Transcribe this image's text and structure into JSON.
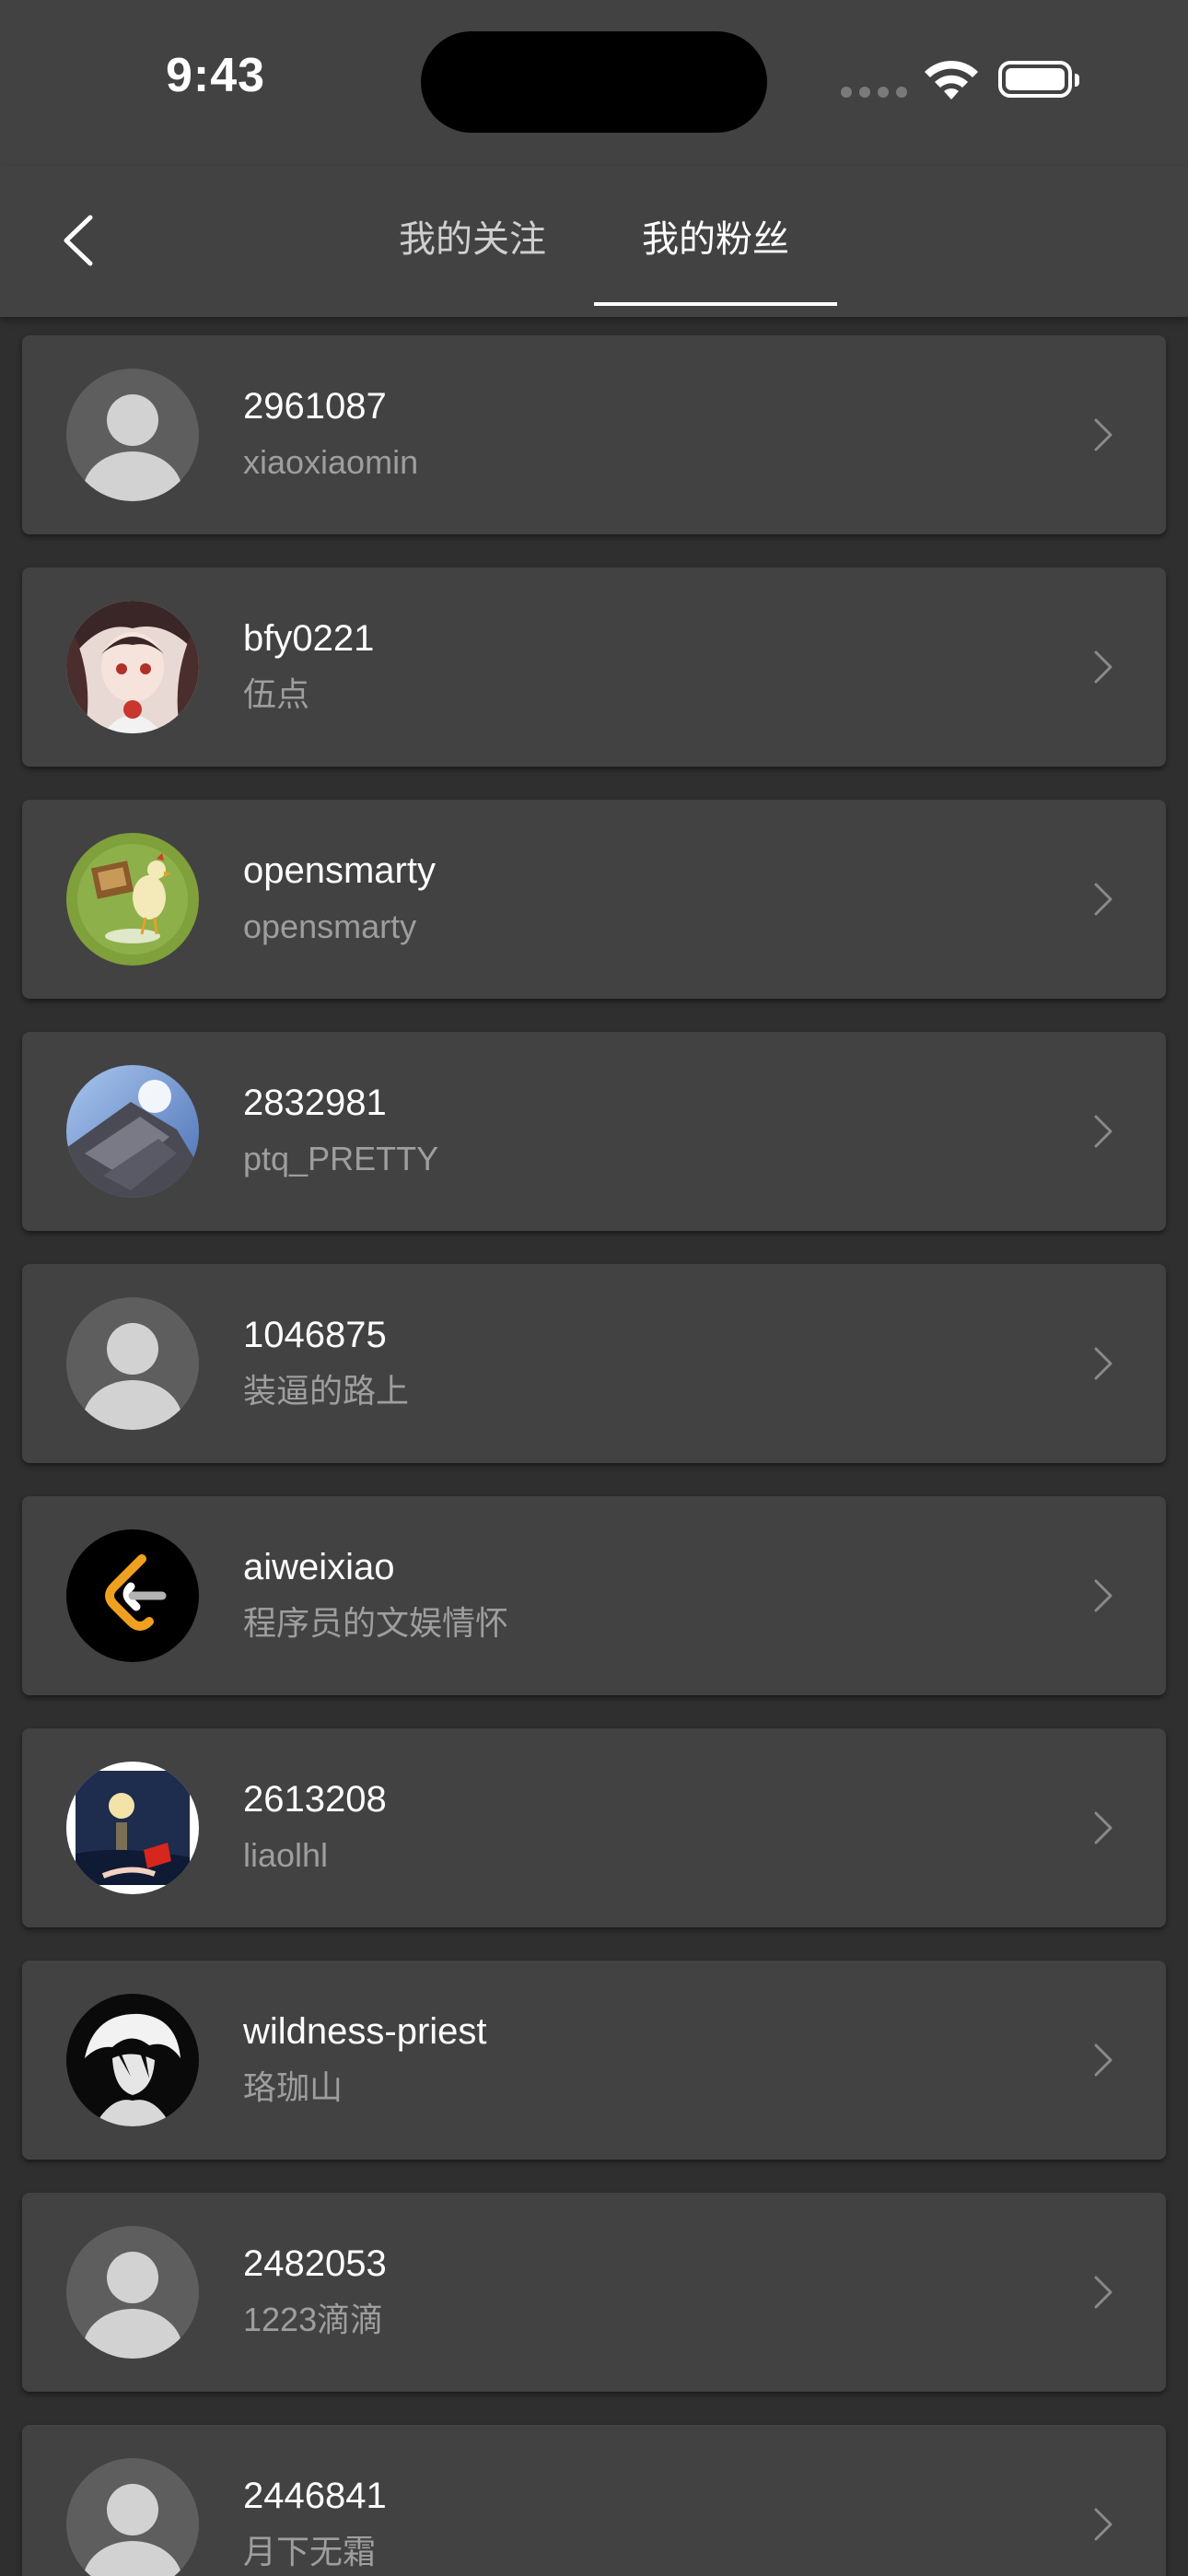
{
  "status_bar": {
    "time": "9:43"
  },
  "nav": {
    "back_icon": "chevron-left-icon",
    "tabs": [
      {
        "label": "我的关注",
        "selected": false
      },
      {
        "label": "我的粉丝",
        "selected": true
      }
    ]
  },
  "followers": [
    {
      "name": "2961087",
      "subtitle": "xiaoxiaomin",
      "avatar": "default-avatar-icon"
    },
    {
      "name": "bfy0221",
      "subtitle": "伍点",
      "avatar": "anime-girl-avatar"
    },
    {
      "name": "opensmarty",
      "subtitle": "opensmarty",
      "avatar": "rooster-avatar"
    },
    {
      "name": "2832981",
      "subtitle": "ptq_PRETTY",
      "avatar": "sky-building-avatar"
    },
    {
      "name": "1046875",
      "subtitle": "装逼的路上",
      "avatar": "default-avatar-icon"
    },
    {
      "name": "aiweixiao",
      "subtitle": "程序员的文娱情怀",
      "avatar": "leetcode-logo-avatar"
    },
    {
      "name": "2613208",
      "subtitle": "liaolhl",
      "avatar": "moon-flag-avatar"
    },
    {
      "name": "wildness-priest",
      "subtitle": "珞珈山",
      "avatar": "ink-portrait-avatar"
    },
    {
      "name": "2482053",
      "subtitle": "1223滴滴",
      "avatar": "default-avatar-icon"
    },
    {
      "name": "2446841",
      "subtitle": "月下无霜",
      "avatar": "default-avatar-icon"
    }
  ],
  "colors": {
    "background": "#2f2f2f",
    "card": "#424242",
    "primary_text": "#ffffff",
    "secondary_text": "#9e9e9e"
  }
}
